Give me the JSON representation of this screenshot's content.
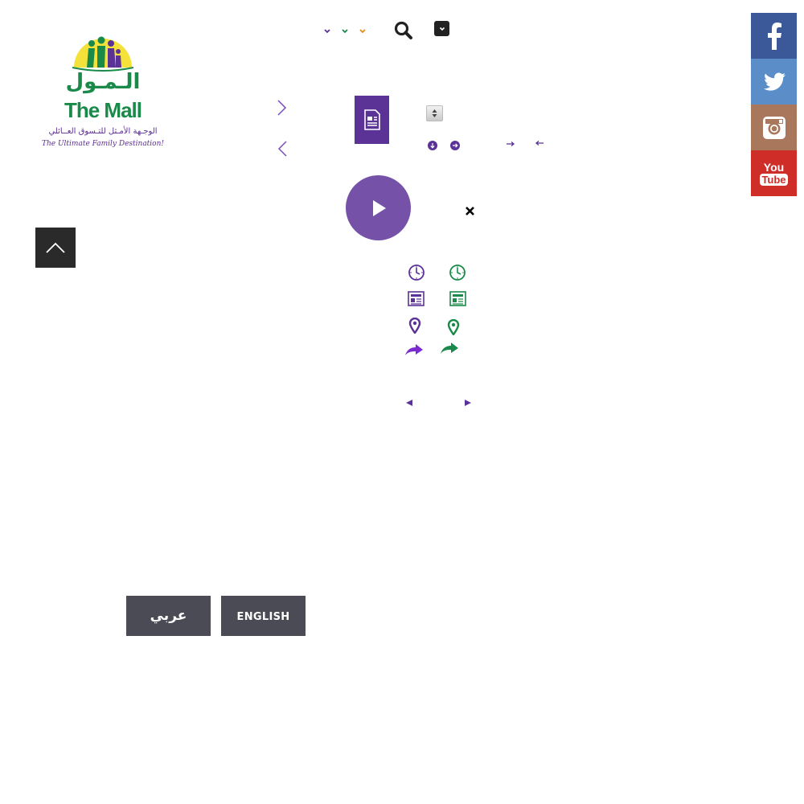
{
  "logo": {
    "brand_ar": "الـمـول",
    "brand_en": "The Mall",
    "tagline_ar": "الوجـهة الأمـثل للتـسوق العــائلي",
    "tagline_en": "The Ultimate Family Destination!"
  },
  "social": {
    "facebook_color": "#3b5998",
    "twitter_color": "#5b8ec9",
    "instagram_color": "#a8775c",
    "youtube_color": "#cf2e28",
    "youtube_label_top": "You",
    "youtube_label_bottom": "Tube"
  },
  "language": {
    "arabic_label": "عربي",
    "english_label": "ENGLISH"
  },
  "colors": {
    "purple": "#5b3296",
    "purple_light": "#7552a8",
    "green": "#1a8a4a",
    "orange": "#e08a1e",
    "dark": "#2a2a2a",
    "gray_button": "#4b4b55"
  },
  "icons": [
    "chevron-down-purple-icon",
    "chevron-down-green-icon",
    "chevron-down-orange-icon",
    "search-icon",
    "dropdown-toggle-icon",
    "arrow-right-icon",
    "arrow-left-icon",
    "document-icon",
    "spinner-icon",
    "circle-down-icon",
    "circle-right-icon",
    "small-arrow-right-icon",
    "small-arrow-left-icon",
    "play-icon",
    "close-icon",
    "clock-icon",
    "news-icon",
    "location-pin-icon",
    "share-icon",
    "triangle-left-icon",
    "triangle-right-icon",
    "chevron-up-icon"
  ]
}
